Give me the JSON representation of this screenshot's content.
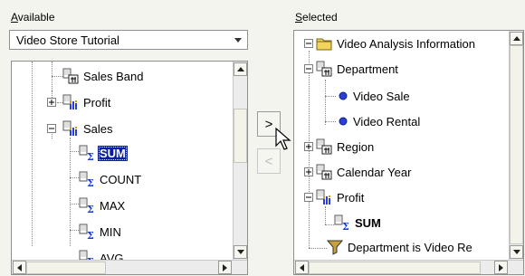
{
  "available": {
    "label": "Available",
    "label_mnemonic": "A",
    "label_rest": "vailable",
    "dropdown_value": "Video Store Tutorial",
    "items": [
      {
        "label": "Sales Band",
        "icon": "dimension-icon",
        "expander": "none"
      },
      {
        "label": "Profit",
        "icon": "measure-folder-icon",
        "expander": "plus"
      },
      {
        "label": "Sales",
        "icon": "measure-folder-icon",
        "expander": "minus"
      },
      {
        "label": "SUM",
        "icon": "sum-aggregate-icon",
        "selected": true
      },
      {
        "label": "COUNT",
        "icon": "sum-aggregate-icon"
      },
      {
        "label": "MAX",
        "icon": "sum-aggregate-icon"
      },
      {
        "label": "MIN",
        "icon": "sum-aggregate-icon"
      },
      {
        "label": "AVG",
        "icon": "sum-aggregate-icon"
      }
    ]
  },
  "selected": {
    "label": "Selected",
    "label_mnemonic": "S",
    "label_rest": "elected",
    "items": [
      {
        "label": "Video Analysis Information",
        "icon": "folder-icon",
        "expander": "minus"
      },
      {
        "label": "Department",
        "icon": "dimension-icon",
        "expander": "minus"
      },
      {
        "label": "Video Sale",
        "icon": "item-dot-icon"
      },
      {
        "label": "Video Rental",
        "icon": "item-dot-icon"
      },
      {
        "label": "Region",
        "icon": "dimension-icon",
        "expander": "plus"
      },
      {
        "label": "Calendar Year",
        "icon": "dimension-icon",
        "expander": "plus"
      },
      {
        "label": "Profit",
        "icon": "measure-folder-icon",
        "expander": "minus"
      },
      {
        "label": "SUM",
        "icon": "sum-aggregate-icon",
        "bold": true
      },
      {
        "label": "Department is Video Re",
        "icon": "filter-icon"
      }
    ]
  },
  "buttons": {
    "add": ">",
    "remove": "<"
  },
  "colors": {
    "background": "#f4f4ee",
    "selection": "#0a1f9c",
    "item_dot": "#2b3fd6"
  }
}
